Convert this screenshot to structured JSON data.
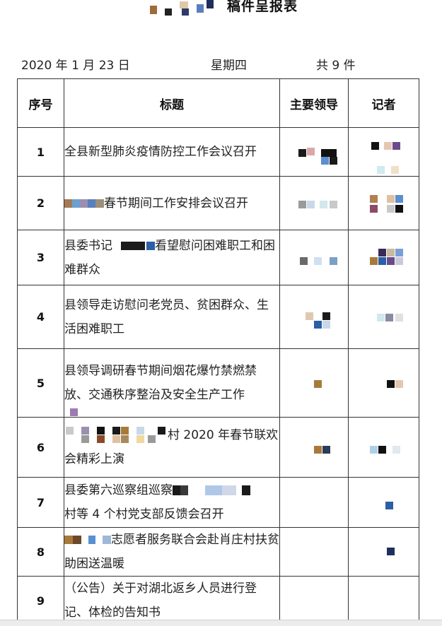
{
  "header": {
    "title": "稿件呈报表",
    "date": "2020 年 1 月 23 日",
    "weekday": "星期四",
    "count": "共 9 件"
  },
  "table": {
    "columns": [
      "序号",
      "标题",
      "主要领导",
      "记者"
    ],
    "rows": [
      {
        "no": "1",
        "title": "全县新型肺炎疫情防控工作会议召开"
      },
      {
        "no": "2",
        "title": "春节期间工作安排会议召开"
      },
      {
        "no": "3",
        "title": "县委书记",
        "title_tail": "看望慰问困难职工和困难群众"
      },
      {
        "no": "4",
        "title": "县领导走访慰问老党员、贫困群众、生活困难职工"
      },
      {
        "no": "5",
        "title": "县领导调研春节期间烟花爆竹禁燃禁放、交通秩序整治及安全生产工作"
      },
      {
        "no": "6",
        "title": "村 2020 年春节联欢会精彩上演"
      },
      {
        "no": "7",
        "title": "县委第六巡察组巡察",
        "title_tail": "村等 4 个村党支部反馈会召开"
      },
      {
        "no": "8",
        "title": "志愿者服务联合会赴肖庄村扶贫助困送温暖"
      },
      {
        "no": "9",
        "title": "（公告）关于对湖北返乡人员进行登记、体检的告知书"
      }
    ]
  },
  "colors": {
    "border": "#333333",
    "mosaic": [
      "#1a1a1a",
      "#2b5fa6",
      "#9b7b4a",
      "#6a4a8a",
      "#c9c9c9",
      "#e8c8a0"
    ]
  }
}
